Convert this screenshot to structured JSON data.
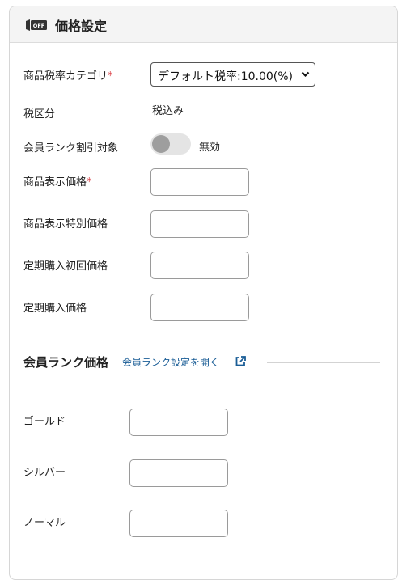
{
  "panel": {
    "title": "価格設定"
  },
  "fields": {
    "tax_category": {
      "label": "商品税率カテゴリ",
      "required_mark": "*",
      "selected": "デフォルト税率:10.00(%)"
    },
    "tax_type": {
      "label": "税区分",
      "value": "税込み"
    },
    "member_discount": {
      "label": "会員ランク割引対象",
      "toggle_text": "無効",
      "enabled": false
    },
    "display_price": {
      "label": "商品表示価格",
      "required_mark": "*",
      "value": ""
    },
    "special_price": {
      "label": "商品表示特別価格",
      "value": ""
    },
    "sub_first_price": {
      "label": "定期購入初回価格",
      "value": ""
    },
    "sub_price": {
      "label": "定期購入価格",
      "value": ""
    }
  },
  "member_rank": {
    "title": "会員ランク価格",
    "link": "会員ランク設定を開く",
    "ranks": [
      {
        "label": "ゴールド",
        "value": ""
      },
      {
        "label": "シルバー",
        "value": ""
      },
      {
        "label": "ノーマル",
        "value": ""
      }
    ]
  },
  "icons": {
    "header": "price-tag-off-icon",
    "link": "external-link-icon",
    "select": "chevron-down-icon"
  },
  "colors": {
    "link": "#1a5d96",
    "required": "#d9363e",
    "toggle_off": "#9e9e9e"
  }
}
